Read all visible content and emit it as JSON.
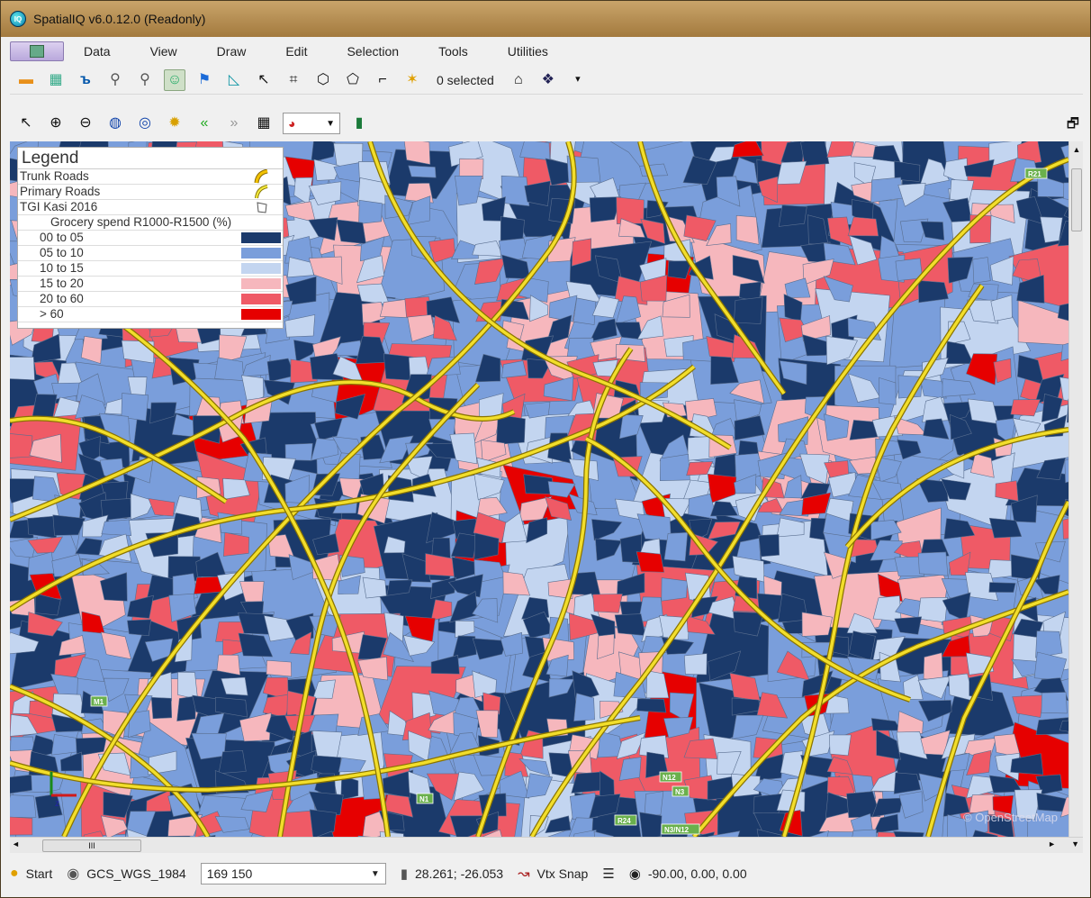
{
  "window": {
    "title": "SpatialIQ v6.0.12.0 (Readonly)",
    "app_icon_text": "IQ"
  },
  "menu": [
    "Data",
    "View",
    "Draw",
    "Edit",
    "Selection",
    "Tools",
    "Utilities"
  ],
  "toolbar1": {
    "selected_count": "0 selected"
  },
  "legend": {
    "title": "Legend",
    "layers": [
      "Trunk Roads",
      "Primary Roads",
      "TGI Kasi 2016"
    ],
    "theme_title": "Grocery spend R1000-R1500 (%)",
    "classes": [
      {
        "label": "00 to 05",
        "color": "#1b3a6b"
      },
      {
        "label": "05 to 10",
        "color": "#7a9edb"
      },
      {
        "label": "10 to 15",
        "color": "#c3d5f0"
      },
      {
        "label": "15 to 20",
        "color": "#f6b7bd"
      },
      {
        "label": "20 to 60",
        "color": "#ef5a66"
      },
      {
        "label": "> 60",
        "color": "#e60000"
      }
    ]
  },
  "map": {
    "road_labels": [
      "R21",
      "M1",
      "N1",
      "N3",
      "N12",
      "R24",
      "N3/N12"
    ],
    "attribution": "© OpenStreetMap",
    "road_color": "#f2de2b"
  },
  "statusbar": {
    "start": "Start",
    "crs": "GCS_WGS_1984",
    "scale_value": "169 150",
    "coords": "28.261; -26.053",
    "snap": "Vtx Snap",
    "view": "-90.00, 0.00, 0.00"
  },
  "hscroll_thumb": "III"
}
